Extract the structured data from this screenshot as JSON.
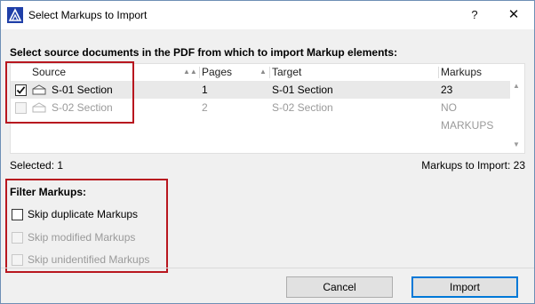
{
  "window": {
    "title": "Select Markups to Import",
    "help_label": "?",
    "close_label": "✕"
  },
  "instruction": "Select source documents in the PDF from which to import Markup elements:",
  "table": {
    "headers": {
      "source": "Source",
      "pages": "Pages",
      "target": "Target",
      "markups": "Markups"
    },
    "rows": [
      {
        "checked": true,
        "enabled": true,
        "source": "S-01 Section",
        "pages": "1",
        "target": "S-01 Section",
        "markups": "23"
      },
      {
        "checked": false,
        "enabled": false,
        "source": "S-02 Section",
        "pages": "2",
        "target": "S-02 Section",
        "markups": "NO MARKUPS"
      }
    ]
  },
  "status": {
    "selected": "Selected: 1",
    "to_import": "Markups to Import: 23"
  },
  "filters": {
    "title": "Filter Markups:",
    "options": [
      {
        "label": "Skip duplicate Markups",
        "checked": false,
        "enabled": true
      },
      {
        "label": "Skip modified Markups",
        "checked": false,
        "enabled": false
      },
      {
        "label": "Skip unidentified Markups",
        "checked": false,
        "enabled": false
      }
    ]
  },
  "buttons": {
    "cancel": "Cancel",
    "import": "Import"
  },
  "colors": {
    "highlight": "#b8171f",
    "default_button_border": "#0078d7"
  }
}
